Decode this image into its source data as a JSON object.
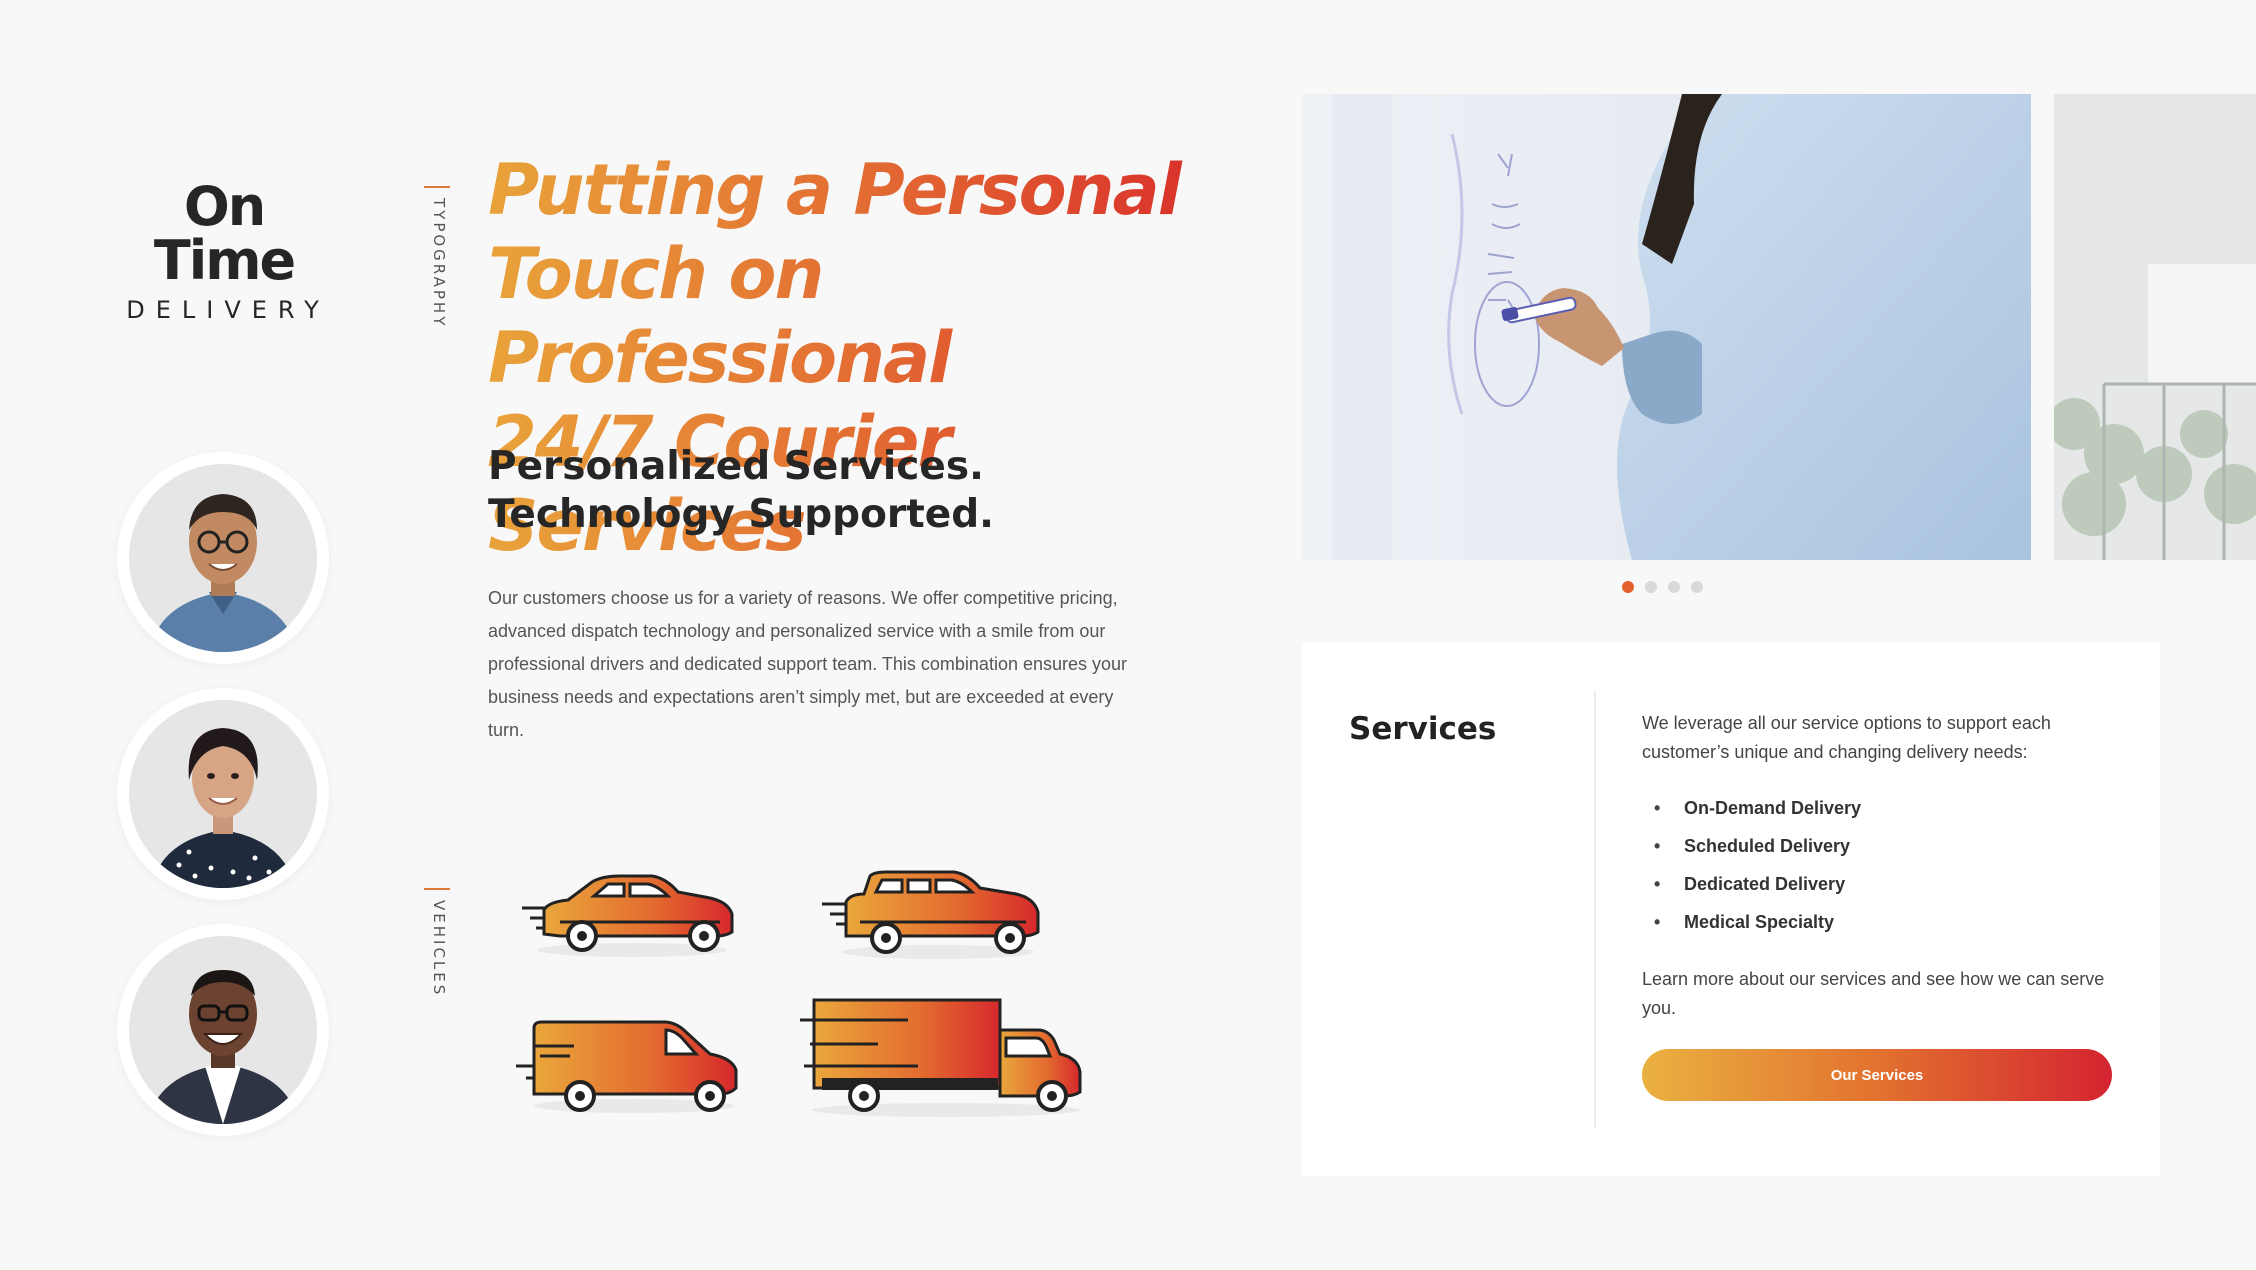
{
  "brand": {
    "name": "On Time",
    "tagline": "DELIVERY"
  },
  "labels": {
    "typography": "TYPOGRAPHY",
    "vehicles": "VEHICLES"
  },
  "hero": {
    "headline_line1": "Putting a Personal",
    "headline_line2": "Touch on Professional",
    "headline_line3": "24/7 Courier Services",
    "subhead_line1": "Personalized Services.",
    "subhead_line2": "Technology Supported.",
    "paragraph": "Our customers choose us for a variety of reasons. We offer competitive pricing, advanced dispatch technology and personalized service with a smile from our professional drivers and dedicated support team. This combination ensures your business needs and expectations aren’t simply met, but are exceeded at every turn."
  },
  "slider": {
    "slide_count": 4,
    "active_index": 0
  },
  "services": {
    "title": "Services",
    "intro": "We leverage all our service options to support each customer’s unique and changing delivery needs:",
    "items": [
      "On-Demand Delivery",
      "Scheduled Delivery",
      "Dedicated Delivery",
      "Medical Specialty"
    ],
    "outro": "Learn more about our services and see how we can serve you.",
    "button_label": "Our Services"
  },
  "colors": {
    "gradient_start": "#e9a33a",
    "gradient_mid": "#e36b32",
    "gradient_end": "#d8282a",
    "text_dark": "#262626",
    "dot_active": "#e2612f"
  }
}
